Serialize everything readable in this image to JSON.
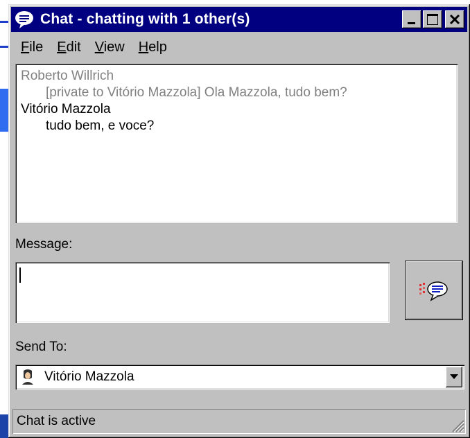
{
  "window": {
    "title": "Chat - chatting with 1 other(s)"
  },
  "menu": {
    "items": [
      {
        "label": "File",
        "accel": "F",
        "rest": "ile"
      },
      {
        "label": "Edit",
        "accel": "E",
        "rest": "dit"
      },
      {
        "label": "View",
        "accel": "V",
        "rest": "iew"
      },
      {
        "label": "Help",
        "accel": "H",
        "rest": "elp"
      }
    ]
  },
  "chat_log": {
    "messages": [
      {
        "sender": "Roberto Willrich",
        "text": "[private to  Vitório Mazzola] Ola Mazzola, tudo bem?",
        "style": "private"
      },
      {
        "sender": "Vitório Mazzola",
        "text": "tudo bem, e voce?",
        "style": "normal"
      }
    ]
  },
  "message": {
    "label": "Message:",
    "value": ""
  },
  "send_to": {
    "label": "Send To:",
    "selected": "Vitório Mazzola"
  },
  "status": {
    "text": "Chat is active"
  },
  "icons": {
    "title": "chat-bubble-icon",
    "send": "send-message-icon",
    "recipient": "user-avatar-icon"
  },
  "colors": {
    "titlebar": "#000080",
    "face": "#c0c0c0",
    "private_text": "#808080"
  }
}
